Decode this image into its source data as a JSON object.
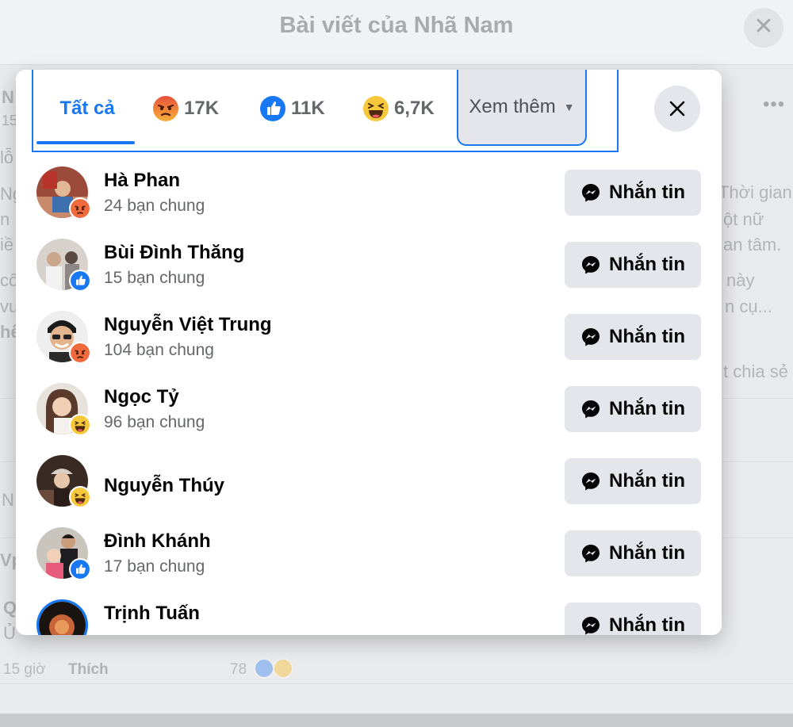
{
  "background": {
    "title": "Bài viết của Nhã Nam",
    "fragments": {
      "right1": "Thời gian",
      "right2": "ột nữ",
      "right3": "an tâm.",
      "right4": "này",
      "right5": "n cụ...",
      "right6": "t chia sẻ",
      "left_n1": "N",
      "left_15": "15",
      "left_o": "lỗ",
      "left_ng": "Ng",
      "left_n2": "n",
      "left_ie": "iề",
      "left_co": "cố",
      "left_vu": "vu",
      "left_he": "hê",
      "left_n3": "N",
      "left_vp": "Vp",
      "left_q": "Q",
      "left_u": "Ủ"
    },
    "comment_time": "15 giờ",
    "comment_like": "Thích",
    "comment_reactions": "78"
  },
  "modal": {
    "tabs": {
      "all": "Tất cả",
      "angry_count": "17K",
      "like_count": "11K",
      "haha_count": "6,7K",
      "more": "Xem thêm"
    },
    "message_label": "Nhắn tin",
    "people": [
      {
        "name": "Hà Phan",
        "mutual": "24 bạn chung",
        "reaction": "angry"
      },
      {
        "name": "Bùi Đình Thăng",
        "mutual": "15 bạn chung",
        "reaction": "like"
      },
      {
        "name": "Nguyễn Việt Trung",
        "mutual": "104 bạn chung",
        "reaction": "angry"
      },
      {
        "name": "Ngọc Tỷ",
        "mutual": "96 bạn chung",
        "reaction": "haha"
      },
      {
        "name": "Nguyễn Thúy",
        "mutual": "",
        "reaction": "haha"
      },
      {
        "name": "Đình Khánh",
        "mutual": "17 bạn chung",
        "reaction": "like"
      },
      {
        "name": "Trịnh Tuấn",
        "mutual": "",
        "reaction": ""
      }
    ]
  },
  "colors": {
    "accent": "#1877f2",
    "button_bg": "#e4e6eb",
    "secondary_text": "#65676b"
  }
}
